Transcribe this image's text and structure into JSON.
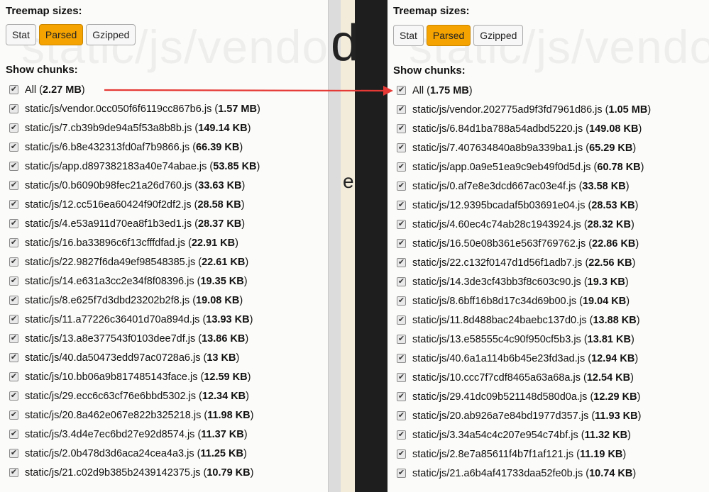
{
  "left": {
    "treemap_label": "Treemap sizes:",
    "buttons": [
      {
        "label": "Stat",
        "active": false
      },
      {
        "label": "Parsed",
        "active": true
      },
      {
        "label": "Gzipped",
        "active": false
      }
    ],
    "chunks_label": "Show chunks:",
    "watermark": "static/js/vendo",
    "chunks": [
      {
        "name": "All",
        "size": "2.27 MB"
      },
      {
        "name": "static/js/vendor.0cc050f6f6119cc867b6.js",
        "size": "1.57 MB"
      },
      {
        "name": "static/js/7.cb39b9de94a5f53a8b8b.js",
        "size": "149.14 KB"
      },
      {
        "name": "static/js/6.b8e432313fd0af7b9866.js",
        "size": "66.39 KB"
      },
      {
        "name": "static/js/app.d897382183a40e74abae.js",
        "size": "53.85 KB"
      },
      {
        "name": "static/js/0.b6090b98fec21a26d760.js",
        "size": "33.63 KB"
      },
      {
        "name": "static/js/12.cc516ea60424f90f2df2.js",
        "size": "28.58 KB"
      },
      {
        "name": "static/js/4.e53a911d70ea8f1b3ed1.js",
        "size": "28.37 KB"
      },
      {
        "name": "static/js/16.ba33896c6f13cfffdfad.js",
        "size": "22.91 KB"
      },
      {
        "name": "static/js/22.9827f6da49ef98548385.js",
        "size": "22.61 KB"
      },
      {
        "name": "static/js/14.e631a3cc2e34f8f08396.js",
        "size": "19.35 KB"
      },
      {
        "name": "static/js/8.e625f7d3dbd23202b2f8.js",
        "size": "19.08 KB"
      },
      {
        "name": "static/js/11.a77226c36401d70a894d.js",
        "size": "13.93 KB"
      },
      {
        "name": "static/js/13.a8e377543f0103dee7df.js",
        "size": "13.86 KB"
      },
      {
        "name": "static/js/40.da50473edd97ac0728a6.js",
        "size": "13 KB"
      },
      {
        "name": "static/js/10.bb06a9b817485143face.js",
        "size": "12.59 KB"
      },
      {
        "name": "static/js/29.ecc6c63cf76e6bbd5302.js",
        "size": "12.34 KB"
      },
      {
        "name": "static/js/20.8a462e067e822b325218.js",
        "size": "11.98 KB"
      },
      {
        "name": "static/js/3.4d4e7ec6bd27e92d8574.js",
        "size": "11.37 KB"
      },
      {
        "name": "static/js/2.0b478d3d6aca24cea4a3.js",
        "size": "11.25 KB"
      },
      {
        "name": "static/js/21.c02d9b385b2439142375.js",
        "size": "10.79 KB"
      }
    ]
  },
  "right": {
    "treemap_label": "Treemap sizes:",
    "buttons": [
      {
        "label": "Stat",
        "active": false
      },
      {
        "label": "Parsed",
        "active": true
      },
      {
        "label": "Gzipped",
        "active": false
      }
    ],
    "chunks_label": "Show chunks:",
    "watermark": "static/js/vendo",
    "chunks": [
      {
        "name": "All",
        "size": "1.75 MB"
      },
      {
        "name": "static/js/vendor.202775ad9f3fd7961d86.js",
        "size": "1.05 MB"
      },
      {
        "name": "static/js/6.84d1ba788a54adbd5220.js",
        "size": "149.08 KB"
      },
      {
        "name": "static/js/7.407634840a8b9a339ba1.js",
        "size": "65.29 KB"
      },
      {
        "name": "static/js/app.0a9e51ea9c9eb49f0d5d.js",
        "size": "60.78 KB"
      },
      {
        "name": "static/js/0.af7e8e3dcd667ac03e4f.js",
        "size": "33.58 KB"
      },
      {
        "name": "static/js/12.9395bcadaf5b03691e04.js",
        "size": "28.53 KB"
      },
      {
        "name": "static/js/4.60ec4c74ab28c1943924.js",
        "size": "28.32 KB"
      },
      {
        "name": "static/js/16.50e08b361e563f769762.js",
        "size": "22.86 KB"
      },
      {
        "name": "static/js/22.c132f0147d1d56f1adb7.js",
        "size": "22.56 KB"
      },
      {
        "name": "static/js/14.3de3cf43bb3f8c603c90.js",
        "size": "19.3 KB"
      },
      {
        "name": "static/js/8.6bff16b8d17c34d69b00.js",
        "size": "19.04 KB"
      },
      {
        "name": "static/js/11.8d488bac24baebc137d0.js",
        "size": "13.88 KB"
      },
      {
        "name": "static/js/13.e58555c4c90f950cf5b3.js",
        "size": "13.81 KB"
      },
      {
        "name": "static/js/40.6a1a114b6b45e23fd3ad.js",
        "size": "12.94 KB"
      },
      {
        "name": "static/js/10.ccc7f7cdf8465a63a68a.js",
        "size": "12.54 KB"
      },
      {
        "name": "static/js/29.41dc09b521148d580d0a.js",
        "size": "12.29 KB"
      },
      {
        "name": "static/js/20.ab926a7e84bd1977d357.js",
        "size": "11.93 KB"
      },
      {
        "name": "static/js/3.34a54c4c207e954c74bf.js",
        "size": "11.32 KB"
      },
      {
        "name": "static/js/2.8e7a85611f4b7f1af121.js",
        "size": "11.19 KB"
      },
      {
        "name": "static/js/21.a6b4af41733daa52fe0b.js",
        "size": "10.74 KB"
      }
    ]
  },
  "background": {
    "letter_d": "d",
    "letter_e": "e"
  },
  "colors": {
    "active_button": "#f5a300",
    "arrow": "#e53935"
  }
}
